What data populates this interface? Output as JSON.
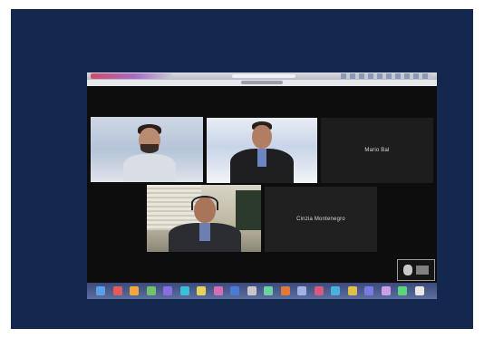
{
  "meeting": {
    "participants": [
      {
        "name": ""
      },
      {
        "name": ""
      },
      {
        "name": "Mario Bal"
      },
      {
        "name": ""
      },
      {
        "name": "Cinzia Montenegro"
      }
    ]
  },
  "colors": {
    "frame": "#14284d",
    "meeting_background": "#0d0d0d",
    "tile_placeholder": "#1d1d1d"
  },
  "dock": {
    "icons": [
      "#5aa0e6",
      "#e25b5b",
      "#f2a93b",
      "#6fc36b",
      "#8a6de0",
      "#3bbfd6",
      "#e6d45a",
      "#d46fb5",
      "#4a7bd6",
      "#c7c7c7",
      "#6bd1a0",
      "#e07a3b",
      "#9fb3e8",
      "#d95a7d",
      "#4ab0e0",
      "#e0c04a",
      "#7a7ae0",
      "#c9a0e8",
      "#5ad67a",
      "#e8e8e8"
    ]
  }
}
